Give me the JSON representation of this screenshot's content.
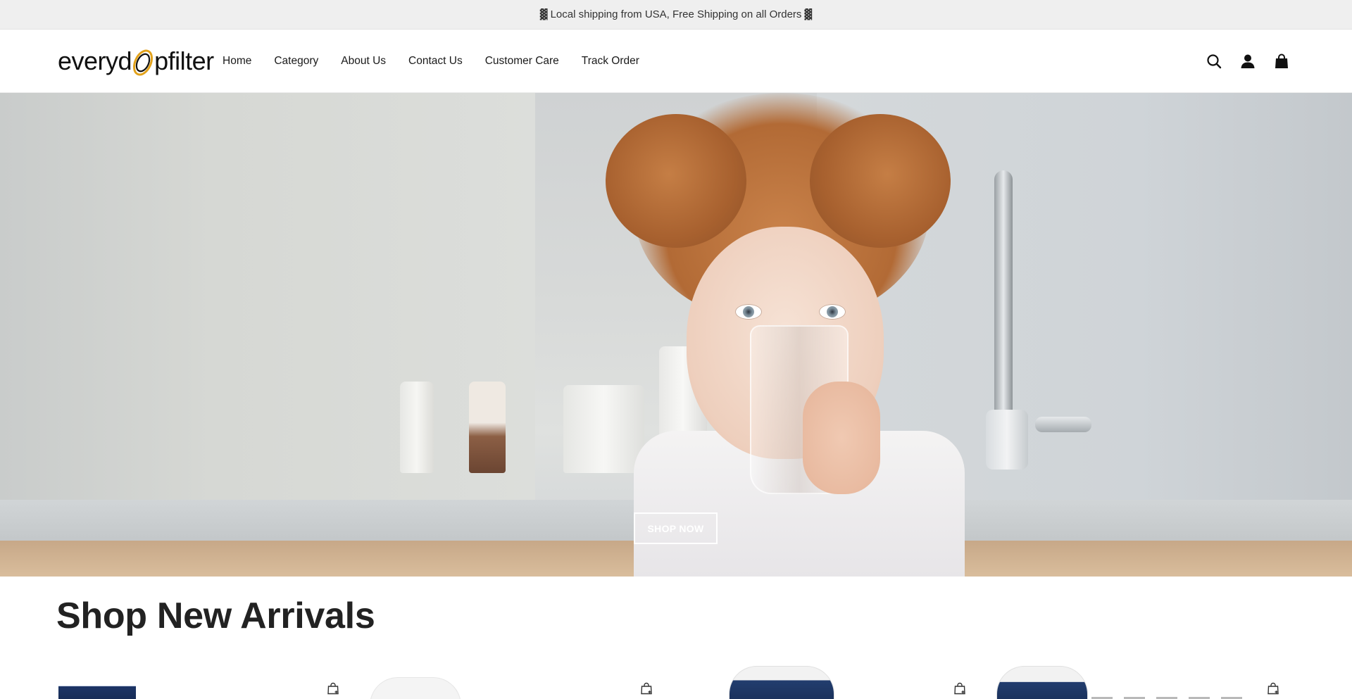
{
  "announcement": {
    "text": "Local shipping from USA, Free Shipping on all Orders",
    "left_glyph": "▓",
    "right_glyph": "▓"
  },
  "header": {
    "logo": {
      "prefix": "everyd",
      "suffix": "pfilter"
    },
    "nav": [
      "Home",
      "Category",
      "About Us",
      "Contact Us",
      "Customer Care",
      "Track Order"
    ],
    "icons": [
      "search-icon",
      "account-icon",
      "bag-icon"
    ]
  },
  "hero": {
    "button_label": "SHOP NOW"
  },
  "new_arrivals": {
    "title": "Shop New Arrivals",
    "products": [
      {
        "icon": "add-to-cart-icon"
      },
      {
        "icon": "add-to-cart-icon"
      },
      {
        "icon": "add-to-cart-icon"
      },
      {
        "icon": "add-to-cart-icon"
      }
    ]
  },
  "colors": {
    "announce_bg": "#efefef",
    "logo_accent": "#e2a21b",
    "text": "#222222"
  }
}
